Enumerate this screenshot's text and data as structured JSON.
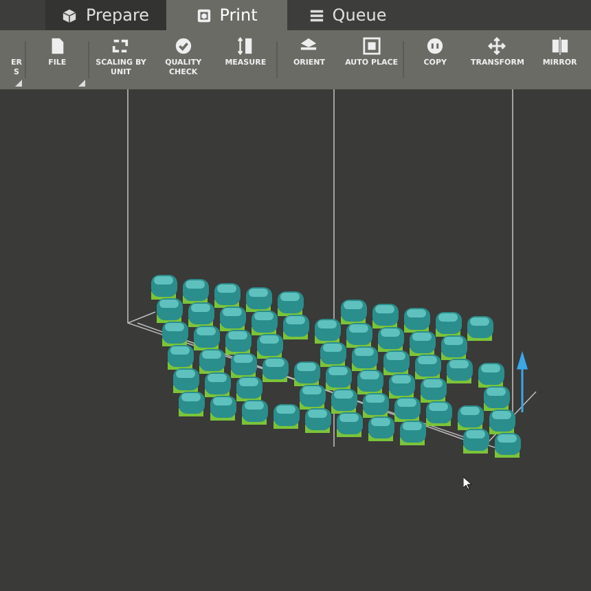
{
  "tabs": [
    {
      "label": "Prepare",
      "selected": false
    },
    {
      "label": "Print",
      "selected": true
    },
    {
      "label": "Queue",
      "selected": false
    }
  ],
  "toolbar": [
    {
      "label": "ER S",
      "menu": true,
      "separator": true
    },
    {
      "label": "FILE",
      "menu": true,
      "separator": true
    },
    {
      "label": "SCALING BY UNIT",
      "menu": false,
      "separator": false
    },
    {
      "label": "QUALITY CHECK",
      "menu": false,
      "separator": false
    },
    {
      "label": "MEASURE",
      "menu": false,
      "separator": true
    },
    {
      "label": "ORIENT",
      "menu": false,
      "separator": false
    },
    {
      "label": "AUTO PLACE",
      "menu": false,
      "separator": true
    },
    {
      "label": "COPY",
      "menu": false,
      "separator": false
    },
    {
      "label": "TRANSFORM",
      "menu": false,
      "separator": false
    },
    {
      "label": "MIRROR",
      "menu": false,
      "separator": false
    }
  ]
}
